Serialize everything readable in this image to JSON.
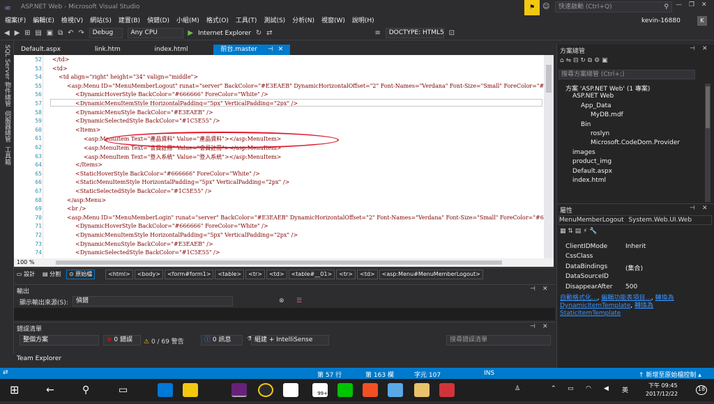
{
  "window": {
    "title": "ASP.NET Web - Microsoft Visual Studio",
    "quick_launch": "快速啟動 (Ctrl+Q)",
    "user": "kevin-16880",
    "user_initial": "K"
  },
  "menu": [
    "檔案(F)",
    "編輯(E)",
    "檢視(V)",
    "網站(S)",
    "建置(B)",
    "偵錯(D)",
    "小組(M)",
    "格式(O)",
    "工具(T)",
    "測試(S)",
    "分析(N)",
    "視窗(W)",
    "說明(H)"
  ],
  "toolbar": {
    "config": "Debug",
    "platform": "Any CPU",
    "run": "Internet Explorer",
    "doctype": "DOCTYPE: HTML5"
  },
  "left_tools": [
    "SQL Server 物件總管",
    "伺服器總管",
    "工具箱"
  ],
  "tabs": [
    "Default.aspx",
    "link.htm",
    "index.html",
    "前台.master"
  ],
  "editor": {
    "lines": [
      {
        "n": "52",
        "c": "</td>"
      },
      {
        "n": "53",
        "c": "<td>"
      },
      {
        "n": "54",
        "c": "<td align=\"right\" height=\"34\" valign=\"middle\">"
      },
      {
        "n": "55",
        "c": "<asp:Menu ID=\"MenuMemberLogout\" runat=\"server\" BackColor=\"#E3EAEB\" DynamicHorizontalOffset=\"2\" Font-Names=\"Verdana\" Font-Size=\"Small\" ForeColor=\"#6666"
      },
      {
        "n": "56",
        "c": "<DynamicHoverStyle BackColor=\"#666666\" ForeColor=\"White\" />"
      },
      {
        "n": "57",
        "c": "<DynamicMenuItemStyle HorizontalPadding=\"5px\" VerticalPadding=\"2px\" />"
      },
      {
        "n": "58",
        "c": "<DynamicMenuStyle BackColor=\"#E3EAEB\" />"
      },
      {
        "n": "59",
        "c": "<DynamicSelectedStyle BackColor=\"#1C5E55\" />"
      },
      {
        "n": "60",
        "c": "<Items>"
      },
      {
        "n": "61",
        "c": "<asp:MenuItem Text=\"產品資料\" Value=\"產品資料\"></asp:MenuItem>"
      },
      {
        "n": "62",
        "c": "<asp:MenuItem Text=\"會員註冊\" Value=\"會員註冊\"></asp:MenuItem>"
      },
      {
        "n": "63",
        "c": "<asp:MenuItem Text=\"登入系統\" Value=\"登入系統\"></asp:MenuItem>"
      },
      {
        "n": "64",
        "c": "</Items>"
      },
      {
        "n": "65",
        "c": "<StaticHoverStyle BackColor=\"#666666\" ForeColor=\"White\" />"
      },
      {
        "n": "66",
        "c": "<StaticMenuItemStyle HorizontalPadding=\"5px\" VerticalPadding=\"2px\" />"
      },
      {
        "n": "67",
        "c": "<StaticSelectedStyle BackColor=\"#1C5E55\" />"
      },
      {
        "n": "68",
        "c": "</asp:Menu>"
      },
      {
        "n": "69",
        "c": "<br />"
      },
      {
        "n": "70",
        "c": "<asp:Menu ID=\"MenuMemberLogin\" runat=\"server\" BackColor=\"#E3EAEB\" DynamicHorizontalOffset=\"2\" Font-Names=\"Verdana\" Font-Size=\"Small\" ForeColor=\"#6666"
      },
      {
        "n": "71",
        "c": "<DynamicHoverStyle BackColor=\"#666666\" ForeColor=\"White\" />"
      },
      {
        "n": "72",
        "c": "<DynamicMenuItemStyle HorizontalPadding=\"5px\" VerticalPadding=\"2px\" />"
      },
      {
        "n": "73",
        "c": "<DynamicMenuStyle BackColor=\"#E3EAEB\" />"
      },
      {
        "n": "74",
        "c": "<DynamicSelectedStyle BackColor=\"#1C5E55\" />"
      }
    ],
    "zoom": "100 %"
  },
  "views": {
    "design": "設計",
    "split": "分割",
    "source": "原始檔"
  },
  "breadcrumbs": [
    "<html>",
    "<body>",
    "<form#form1>",
    "<table>",
    "<tr>",
    "<td>",
    "<table#__01>",
    "<tr>",
    "<td>",
    "<asp:Menu#MenuMemberLogout>"
  ],
  "output": {
    "title": "輸出",
    "source_label": "顯示輸出來源(S):",
    "source_value": "偵錯"
  },
  "errors": {
    "title": "錯誤清單",
    "scope": "整個方案",
    "errors": "0 錯誤",
    "warnings": "0 / 69 警告",
    "messages": "0 訊息",
    "build": "組建 + IntelliSense",
    "search": "搜尋錯誤清單"
  },
  "team_explorer": "Team Explorer",
  "solution": {
    "title": "方案總管",
    "search": "搜尋方案總管 (Ctrl+;)",
    "items": [
      "方案 'ASP.NET Web' (1 專案)",
      "ASP.NET Web",
      "App_Data",
      "MyDB.mdf",
      "Bin",
      "roslyn",
      "Microsoft.CodeDom.Provider",
      "images",
      "product_img",
      "Default.aspx",
      "index.html"
    ]
  },
  "properties": {
    "title": "屬性",
    "object": "MenuMemberLogout",
    "type": "System.Web.UI.Web",
    "rows": [
      {
        "n": "ClientIDMode",
        "v": "Inherit"
      },
      {
        "n": "CssClass",
        "v": ""
      },
      {
        "n": "DataBindings",
        "v": "(集合)"
      },
      {
        "n": "DataSourceID",
        "v": ""
      },
      {
        "n": "DisappearAfter",
        "v": "500"
      }
    ],
    "links": {
      "auto": "自動格式化...",
      "edit": "編輯功能表項目...",
      "conv1": "轉換為 DynamicItemTemplate",
      "conv2": "轉換為 StaticItemTemplate"
    }
  },
  "status": {
    "line": "第 57 行",
    "col": "第 163 欄",
    "char": "字元 107",
    "ins": "INS",
    "source_control": "新增至原始檔控制"
  },
  "taskbar": {
    "time": "下午 09:45",
    "date": "2017/12/22",
    "ime": "英",
    "badge": "99+",
    "notif": "18"
  }
}
